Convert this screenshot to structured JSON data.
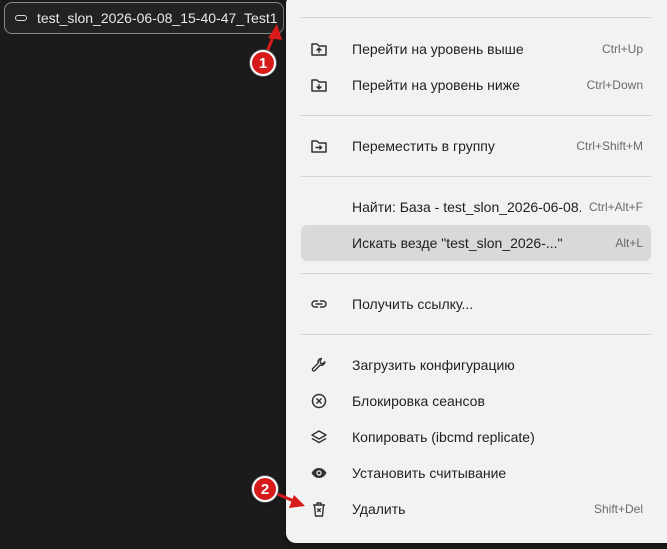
{
  "object_chip": {
    "label": "test_slon_2026-06-08_15-40-47_Test1",
    "icon": "database-item-icon"
  },
  "menu": {
    "items": [
      {
        "label": "Перейти на уровень выше",
        "shortcut": "Ctrl+Up",
        "icon": "folder-up-icon"
      },
      {
        "label": "Перейти на уровень ниже",
        "shortcut": "Ctrl+Down",
        "icon": "folder-down-icon"
      },
      {
        "label": "Переместить в группу",
        "shortcut": "Ctrl+Shift+M",
        "icon": "folder-move-icon"
      },
      {
        "label": "Найти: База - test_slon_2026-06-08...",
        "shortcut": "Ctrl+Alt+F",
        "icon": ""
      },
      {
        "label": "Искать везде \"test_slon_2026-...\"",
        "shortcut": "Alt+L",
        "icon": ""
      },
      {
        "label": "Получить ссылку...",
        "shortcut": "",
        "icon": "link-icon"
      },
      {
        "label": "Загрузить конфигурацию",
        "shortcut": "",
        "icon": "wrench-icon"
      },
      {
        "label": "Блокировка сеансов",
        "shortcut": "",
        "icon": "block-icon"
      },
      {
        "label": "Копировать (ibcmd replicate)",
        "shortcut": "",
        "icon": "layers-icon"
      },
      {
        "label": "Установить считывание",
        "shortcut": "",
        "icon": "eye-icon"
      },
      {
        "label": "Удалить",
        "shortcut": "Shift+Del",
        "icon": "trash-icon"
      }
    ]
  },
  "annotations": {
    "badge_1": "1",
    "badge_2": "2",
    "color": "#d71a1a"
  }
}
